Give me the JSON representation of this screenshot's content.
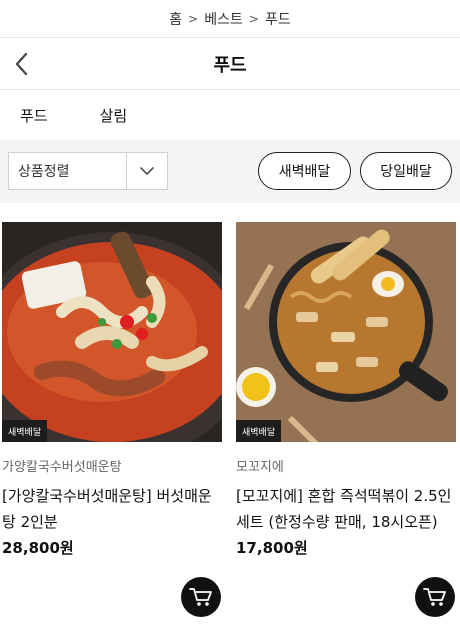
{
  "breadcrumb": {
    "items": [
      "홈",
      "베스트",
      "푸드"
    ]
  },
  "header": {
    "title": "푸드"
  },
  "category_tabs": [
    {
      "label": "푸드"
    },
    {
      "label": "살림"
    }
  ],
  "filter": {
    "sort_label": "상품정렬",
    "dawn_delivery": "새벽배달",
    "same_day_delivery": "당일배달"
  },
  "products": [
    {
      "badge": "새벽배달",
      "brand": "가양칼국수버섯매운탕",
      "name": "[가양칼국수버섯매운탕] 버섯매운탕 2인분",
      "price": "28,800원"
    },
    {
      "badge": "새벽배달",
      "brand": "모꼬지에",
      "name": "[모꼬지에] 혼합 즉석떡볶이 2.5인세트 (한정수량 판매, 18시오픈)",
      "price": "17,800원"
    }
  ],
  "icons": {
    "separator": "chevron-right-icon",
    "back": "chevron-left-icon",
    "sort_dropdown": "chevron-down-icon",
    "cart": "cart-icon"
  }
}
